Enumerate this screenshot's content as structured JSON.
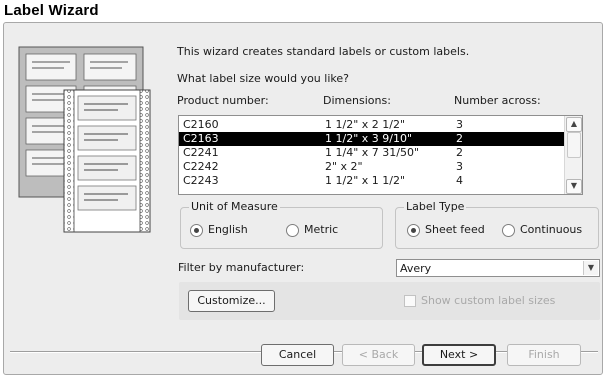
{
  "window": {
    "title": "Label Wizard"
  },
  "intro_text": "This wizard creates standard labels or custom labels.",
  "question_text": "What label size would you like?",
  "columns": [
    "Product number:",
    "Dimensions:",
    "Number across:"
  ],
  "label_list": {
    "rows": [
      {
        "product": "C2160",
        "dimensions": "1 1/2\" x 2 1/2\"",
        "across": "3"
      },
      {
        "product": "C2163",
        "dimensions": "1 1/2\" x 3 9/10\"",
        "across": "2"
      },
      {
        "product": "C2241",
        "dimensions": "1 1/4\" x 7 31/50\"",
        "across": "2"
      },
      {
        "product": "C2242",
        "dimensions": "2\" x 2\"",
        "across": "3"
      },
      {
        "product": "C2243",
        "dimensions": "1 1/2\" x 1 1/2\"",
        "across": "4"
      }
    ],
    "selected_index": 1
  },
  "unit_of_measure": {
    "label": "Unit of Measure",
    "options": [
      "English",
      "Metric"
    ],
    "selected": "English"
  },
  "label_type": {
    "label": "Label Type",
    "options": [
      "Sheet feed",
      "Continuous"
    ],
    "selected": "Sheet feed"
  },
  "filter": {
    "label": "Filter by manufacturer:",
    "value": "Avery"
  },
  "customize_button": "Customize...",
  "show_custom_label": "Show custom label sizes",
  "show_custom_checked": false,
  "buttons": {
    "cancel": "Cancel",
    "back": "< Back",
    "next": "Next >",
    "finish": "Finish"
  },
  "icons": {
    "scroll_up": "up-arrow-icon",
    "scroll_down": "down-arrow-icon",
    "dropdown": "chevron-down-icon",
    "illustration": "label-sheets-illustration"
  }
}
